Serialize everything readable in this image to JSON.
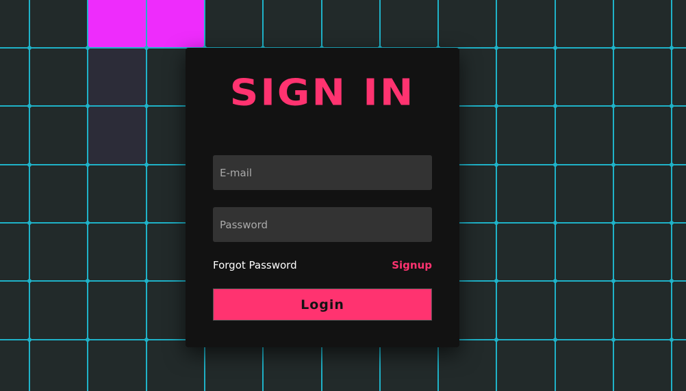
{
  "colors": {
    "background": "#222a2a",
    "grid_line": "#1fb3c9",
    "highlight_cell": "#ee2cfc",
    "dim_cell": "#2c2c38",
    "card": "#121212",
    "accent": "#ff3370",
    "input_bg": "#333333"
  },
  "login_form": {
    "title": "SIGN IN",
    "email_placeholder": "E-mail",
    "password_placeholder": "Password",
    "forgot_password_label": "Forgot Password",
    "signup_label": "Signup",
    "login_button_label": "Login"
  }
}
